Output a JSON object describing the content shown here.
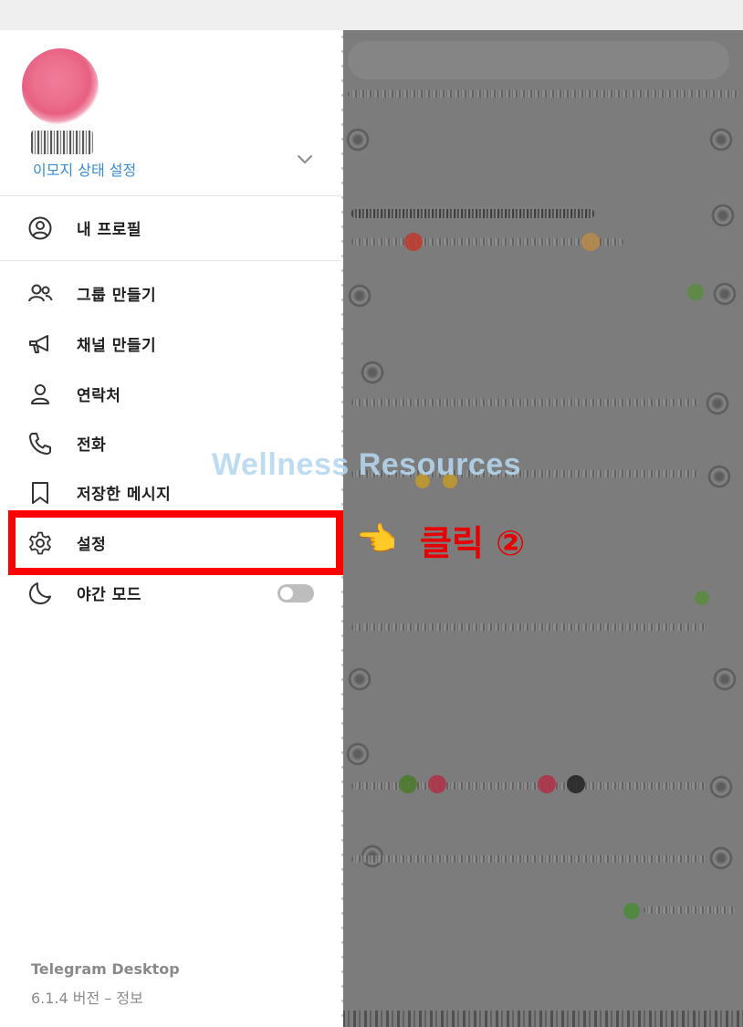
{
  "profile": {
    "status_link": "이모지 상태 설정"
  },
  "menu": {
    "my_profile": "내 프로필",
    "items": [
      {
        "label": "그룹 만들기",
        "icon": "group-icon"
      },
      {
        "label": "채널 만들기",
        "icon": "megaphone-icon"
      },
      {
        "label": "연락처",
        "icon": "contact-icon"
      },
      {
        "label": "전화",
        "icon": "phone-icon"
      },
      {
        "label": "저장한 메시지",
        "icon": "bookmark-icon"
      },
      {
        "label": "설정",
        "icon": "gear-icon"
      },
      {
        "label": "야간 모드",
        "icon": "moon-icon"
      }
    ],
    "night_mode_on": false
  },
  "footer": {
    "app_name": "Telegram Desktop",
    "version_line": "6.1.4 버전 – 정보"
  },
  "overlay": {
    "watermark": "Wellness Resources",
    "pointer_emoji": "👈",
    "click_label": "클릭 ②",
    "highlight_color": "#ff0000"
  }
}
